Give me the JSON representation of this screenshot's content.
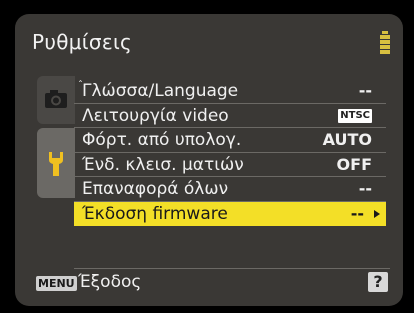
{
  "header": {
    "title": "Ρυθμίσεις",
    "battery_icon": "battery-full-icon"
  },
  "tabs": [
    {
      "name": "shooting",
      "icon": "camera-icon"
    },
    {
      "name": "setup",
      "icon": "wrench-icon",
      "active": true
    }
  ],
  "menu": {
    "items": [
      {
        "label": "Γλώσσα/Language",
        "value": "--"
      },
      {
        "label": "Λειτουργία video",
        "value": "NTSC"
      },
      {
        "label": "Φόρτ. από υπολογ.",
        "value": "AUTO"
      },
      {
        "label": "Ένδ. κλεισ. ματιών",
        "value": "OFF"
      },
      {
        "label": "Επαναφορά όλων",
        "value": "--"
      },
      {
        "label": "Έκδοση firmware",
        "value": "--",
        "selected": true
      }
    ]
  },
  "footer": {
    "menu_button": "MENU",
    "exit_label": "Έξοδος",
    "help_button": "?"
  },
  "colors": {
    "background": "#3a3835",
    "highlight": "#f3df27",
    "accent_icon": "#f0c020"
  }
}
